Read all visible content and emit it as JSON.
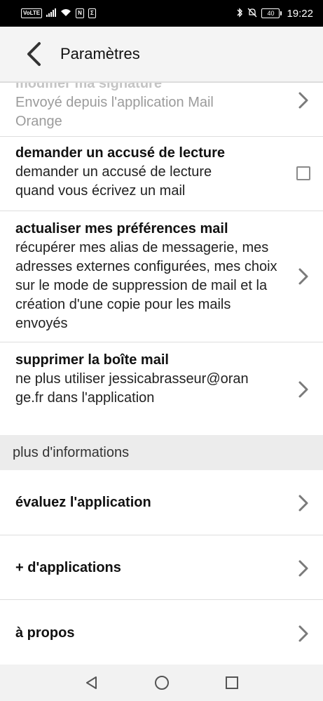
{
  "status_bar": {
    "left_tags": [
      "VoLTE",
      "N",
      "Σ"
    ],
    "battery": "40",
    "time": "19:22"
  },
  "app_bar": {
    "title": "Paramètres",
    "back_icon": "chevron-left-icon"
  },
  "settings": {
    "signature": {
      "title": "modifier ma signature",
      "description": "Envoyé depuis l'application Mail Orange"
    },
    "read_receipt": {
      "title": "demander un accusé de lecture",
      "description": "demander un accusé de lecture quand vous écrivez un mail",
      "checked": false
    },
    "refresh_prefs": {
      "title": "actualiser mes préférences mail",
      "description": "récupérer mes alias de messagerie, mes adresses externes configurées, mes choix sur le mode de suppression de mail et la création d'une copie pour les mails envoyés"
    },
    "delete_mailbox": {
      "title": "supprimer la boîte mail",
      "description": "ne plus utiliser jessicabrasseur@orange.fr dans l'application"
    }
  },
  "more_info": {
    "header": "plus d'informations",
    "items": [
      {
        "label": "évaluez l'application"
      },
      {
        "label": "+ d'applications"
      },
      {
        "label": "à propos"
      }
    ]
  },
  "colors": {
    "status_bar_bg": "#000000",
    "app_bar_bg": "#f4f4f4",
    "section_bg": "#ececec",
    "chevron": "#7a7a7a"
  }
}
